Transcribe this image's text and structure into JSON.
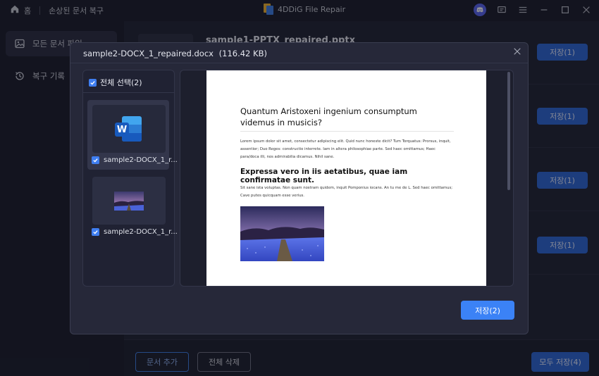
{
  "titlebar": {
    "breadcrumb_home": "홈",
    "breadcrumb_current": "손상된 문서 복구",
    "app_title": "4DDiG File Repair"
  },
  "sidebar": {
    "items": [
      {
        "label": "모든 문서 파일",
        "active": true
      },
      {
        "label": "복구 기록",
        "active": false
      }
    ]
  },
  "main": {
    "rows": [
      {
        "title": "sample1-PPTX_repaired.pptx",
        "save_label": "저장(1)"
      },
      {
        "title": "",
        "save_label": "저장(1)"
      },
      {
        "title": "",
        "save_label": "저장(1)"
      },
      {
        "title": "",
        "save_label": "저장(1)"
      }
    ],
    "footer": {
      "add_label": "문서 추가",
      "clear_label": "전체 삭제",
      "save_all_label": "모두 저장(4)"
    }
  },
  "modal": {
    "filename": "sample2-DOCX_1_repaired.docx",
    "filesize": "(116.42 KB)",
    "select_all_label": "전체 선택(2)",
    "items": [
      {
        "name": "sample2-DOCX_1_r...",
        "kind": "word",
        "checked": true,
        "selected": true
      },
      {
        "name": "sample2-DOCX_1_r...",
        "kind": "image",
        "checked": true,
        "selected": false
      }
    ],
    "save_label": "저장(2)",
    "document": {
      "heading1": "Quantum Aristoxeni ingenium consumptum videmus in musicis?",
      "para1": "Lorem ipsum dolor sit amet, consectetur adipiscing elit. Quid nunc honeste dicit? Tum Torquatus: Prorsus, inquit, assentior; Duo Reges: constructio interrete. Iam in altera philosophiae parte. Sed haec omittamus; Haec para/doca illi, nos admirabilia dicamus. Nihil sane.",
      "heading2": "Expressa vero in iis aetatibus, quae iam confirmatae sunt.",
      "para2": "Sit sane ista voluptas. Non quam nostram quidem, inquit Pomponius iocans. An tu me de L. Sed haec omittamus; Cave putes quicquam esse verius."
    }
  },
  "colors": {
    "accent": "#3b82f6",
    "background": "#1d1f2e",
    "modal": "#262839"
  }
}
